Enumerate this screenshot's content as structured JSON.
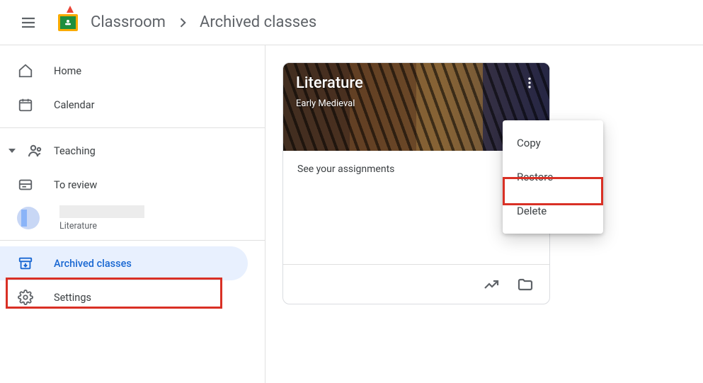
{
  "header": {
    "app_name": "Classroom",
    "page_title": "Archived classes"
  },
  "sidebar": {
    "home": "Home",
    "calendar": "Calendar",
    "teaching": "Teaching",
    "to_review": "To review",
    "class_sub": "Literature",
    "archived": "Archived classes",
    "settings": "Settings"
  },
  "card": {
    "title": "Literature",
    "subtitle": "Early Medieval",
    "body_link": "See your assignments"
  },
  "menu": {
    "copy": "Copy",
    "restore": "Restore",
    "delete": "Delete"
  }
}
